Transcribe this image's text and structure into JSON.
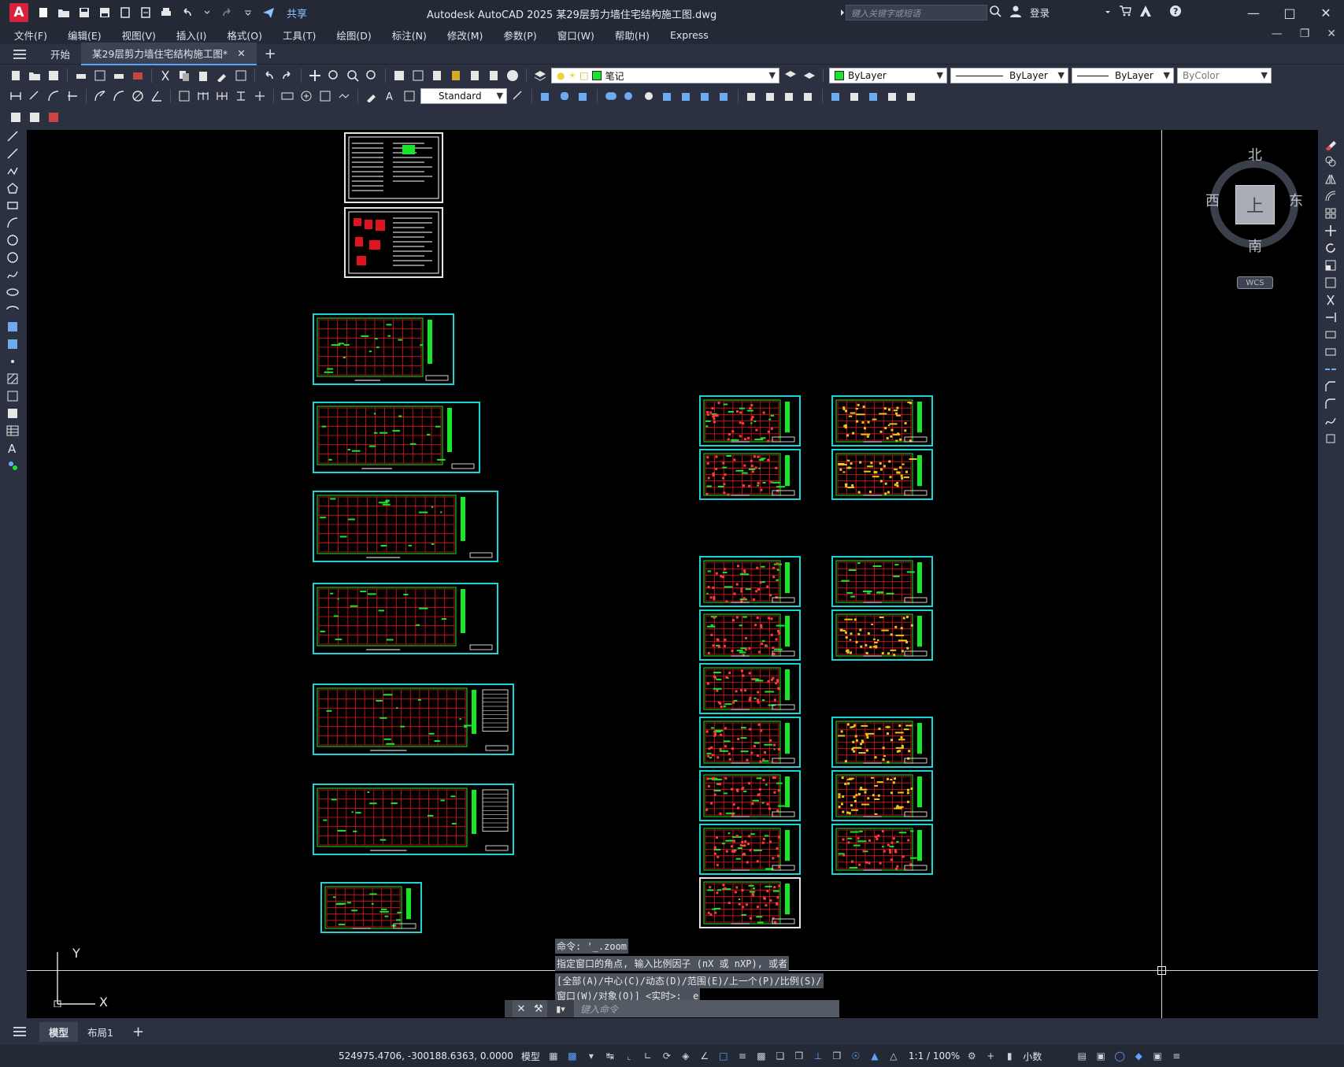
{
  "app": {
    "logo": "A",
    "title": "Autodesk AutoCAD 2025    某29层剪力墙住宅结构施工图.dwg",
    "share": "共享",
    "search_placeholder": "键入关键字或短语",
    "login": "登录"
  },
  "menu": [
    "文件(F)",
    "编辑(E)",
    "视图(V)",
    "插入(I)",
    "格式(O)",
    "工具(T)",
    "绘图(D)",
    "标注(N)",
    "修改(M)",
    "参数(P)",
    "窗口(W)",
    "帮助(H)",
    "Express"
  ],
  "tabs": {
    "start": "开始",
    "active": "某29层剪力墙住宅结构施工图*"
  },
  "toolbar": {
    "layer": "笔记",
    "color": "ByLayer",
    "linetype": "ByLayer",
    "lineweight": "ByLayer",
    "plotstyle": "ByColor",
    "dimstyle": "Standard"
  },
  "viewcube": {
    "north": "北",
    "south": "南",
    "east": "东",
    "west": "西",
    "face": "上",
    "wcs": "WCS"
  },
  "ucs": {
    "x": "X",
    "y": "Y"
  },
  "command": {
    "history": [
      "命令: '_.zoom",
      "指定窗口的角点, 输入比例因子 (nX 或 nXP), 或者",
      "[全部(A)/中心(C)/动态(D)/范围(E)/上一个(P)/比例(S)/",
      "窗口(W)/对象(O)] <实时>: _e"
    ],
    "placeholder": "键入命令"
  },
  "layouts": {
    "model": "模型",
    "layout1": "布局1"
  },
  "status": {
    "coords": "524975.4706, -300188.6363, 0.0000",
    "space": "模型",
    "scale": "1:1 / 100%",
    "units": "小数"
  },
  "colors": {
    "frame": "#19d6d6",
    "grid": "#e0141e",
    "wall": "#19e62a",
    "background": "#000000",
    "ui": "#2b3140"
  }
}
